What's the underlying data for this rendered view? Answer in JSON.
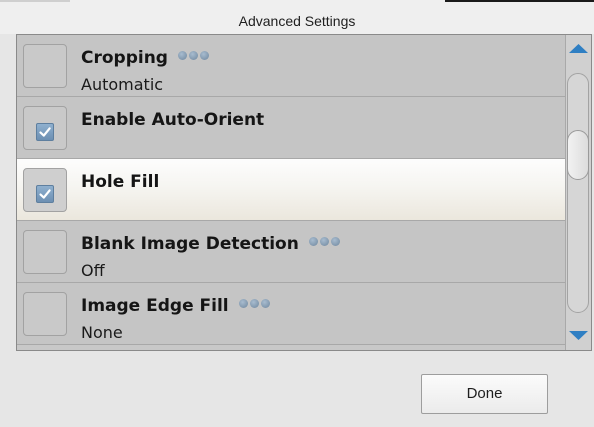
{
  "window": {
    "title": "Advanced Settings"
  },
  "settings": [
    {
      "title": "Cropping",
      "value": "Automatic",
      "checked": false,
      "has_more": true,
      "highlighted": false
    },
    {
      "title": "Enable Auto-Orient",
      "value": "",
      "checked": true,
      "has_more": false,
      "highlighted": false
    },
    {
      "title": "Hole Fill",
      "value": "",
      "checked": true,
      "has_more": false,
      "highlighted": true
    },
    {
      "title": "Blank Image Detection",
      "value": "Off",
      "checked": false,
      "has_more": true,
      "highlighted": false
    },
    {
      "title": "Image Edge Fill",
      "value": "None",
      "checked": false,
      "has_more": true,
      "highlighted": false
    }
  ],
  "icons": {
    "more": "more-options-icon",
    "check": "checkmark-icon",
    "scroll_up": "scroll-up-arrow-icon",
    "scroll_down": "scroll-down-arrow-icon"
  },
  "colors": {
    "accent": "#2f7fc3",
    "row_background": "#c5c5c5",
    "highlight_row": "#f6f5f1"
  },
  "footer": {
    "done_label": "Done"
  }
}
